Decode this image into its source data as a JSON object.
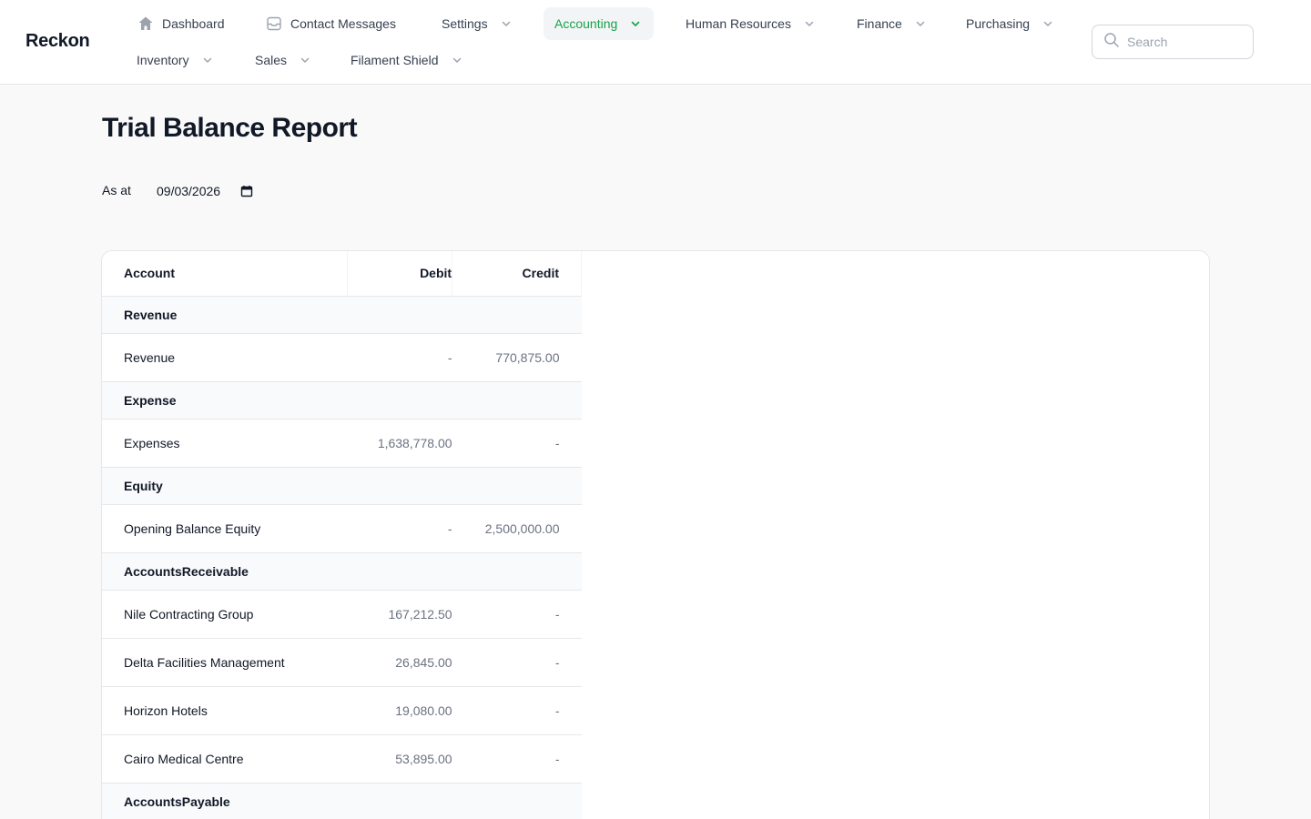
{
  "brand": "Reckon",
  "nav": {
    "dashboard": "Dashboard",
    "contact_messages": "Contact Messages",
    "settings": "Settings",
    "accounting": "Accounting",
    "human_resources": "Human Resources",
    "finance": "Finance",
    "purchasing": "Purchasing",
    "inventory": "Inventory",
    "sales": "Sales",
    "filament_shield": "Filament Shield",
    "active": "Accounting"
  },
  "search": {
    "placeholder": "Search"
  },
  "page": {
    "title": "Trial Balance Report",
    "as_at_label": "As at",
    "as_at_value": "09/03/2026"
  },
  "table": {
    "headers": {
      "account": "Account",
      "debit": "Debit",
      "credit": "Credit"
    },
    "groups": [
      {
        "name": "Revenue",
        "rows": [
          {
            "account": "Revenue",
            "debit": "-",
            "credit": "770,875.00"
          }
        ]
      },
      {
        "name": "Expense",
        "rows": [
          {
            "account": "Expenses",
            "debit": "1,638,778.00",
            "credit": "-"
          }
        ]
      },
      {
        "name": "Equity",
        "rows": [
          {
            "account": "Opening Balance Equity",
            "debit": "-",
            "credit": "2,500,000.00"
          }
        ]
      },
      {
        "name": "AccountsReceivable",
        "rows": [
          {
            "account": "Nile Contracting Group",
            "debit": "167,212.50",
            "credit": "-"
          },
          {
            "account": "Delta Facilities Management",
            "debit": "26,845.00",
            "credit": "-"
          },
          {
            "account": "Horizon Hotels",
            "debit": "19,080.00",
            "credit": "-"
          },
          {
            "account": "Cairo Medical Centre",
            "debit": "53,895.00",
            "credit": "-"
          }
        ]
      },
      {
        "name": "AccountsPayable",
        "rows": []
      }
    ]
  },
  "colors": {
    "accent": "#16a34a",
    "text": "#111827",
    "muted": "#6b7280",
    "border": "#e5e7eb"
  }
}
